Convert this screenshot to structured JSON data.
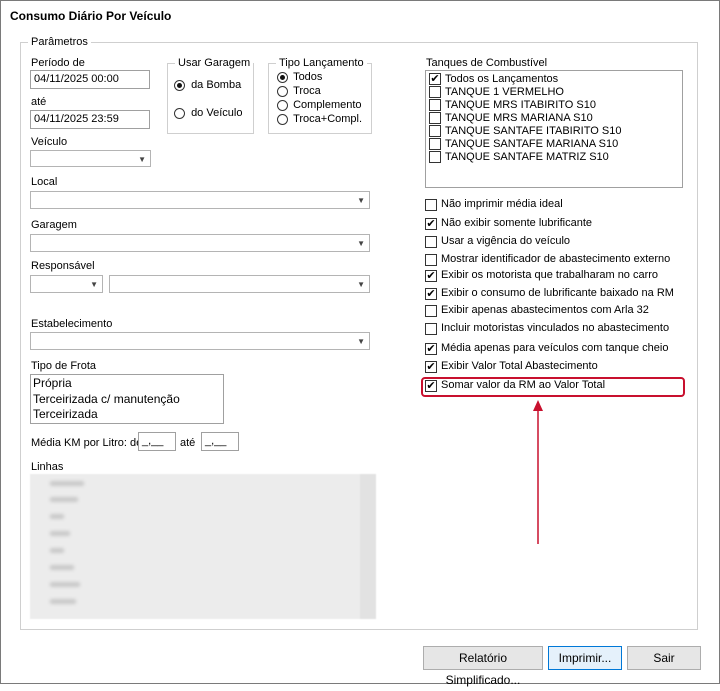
{
  "window": {
    "title": "Consumo Diário Por Veículo"
  },
  "params": {
    "legend": "Parâmetros",
    "periodo_label": "Período de",
    "periodo_de": "04/11/2025 00:00",
    "ate_label": "até",
    "periodo_ate": "04/11/2025 23:59",
    "veiculo_label": "Veículo",
    "local_label": "Local",
    "garagem_label": "Garagem",
    "responsavel_label": "Responsável",
    "estabelecimento_label": "Estabelecimento",
    "tipo_frota_label": "Tipo de Frota",
    "tipo_frota_items": [
      "Própria",
      "Terceirizada c/ manutenção",
      "Terceirizada"
    ],
    "media_km_label": "Média KM por Litro: de",
    "media_km_de": "_,__",
    "media_km_ate_label": "até",
    "media_km_ate": "_,__",
    "linhas_label": "Linhas"
  },
  "usar_garagem": {
    "legend": "Usar Garagem",
    "options": [
      {
        "label": "da Bomba",
        "selected": true
      },
      {
        "label": "do Veículo",
        "selected": false
      }
    ]
  },
  "tipo_lancamento": {
    "legend": "Tipo Lançamento",
    "options": [
      {
        "label": "Todos",
        "selected": true
      },
      {
        "label": "Troca",
        "selected": false
      },
      {
        "label": "Complemento",
        "selected": false
      },
      {
        "label": "Troca+Compl.",
        "selected": false
      }
    ]
  },
  "tanques": {
    "label": "Tanques de Combustível",
    "items": [
      {
        "label": "Todos os Lançamentos",
        "checked": true
      },
      {
        "label": "TANQUE 1 VERMELHO",
        "checked": false
      },
      {
        "label": "TANQUE MRS ITABIRITO S10",
        "checked": false
      },
      {
        "label": "TANQUE MRS MARIANA S10",
        "checked": false
      },
      {
        "label": "TANQUE SANTAFE ITABIRITO S10",
        "checked": false
      },
      {
        "label": "TANQUE SANTAFE MARIANA S10",
        "checked": false
      },
      {
        "label": "TANQUE SANTAFE MATRIZ S10",
        "checked": false
      }
    ]
  },
  "options": [
    {
      "label": "Não imprimir média ideal",
      "checked": false
    },
    {
      "label": "Não exibir somente lubrificante",
      "checked": true
    },
    {
      "label": "Usar a vigência do veículo",
      "checked": false
    },
    {
      "label": "Mostrar identificador de abastecimento externo",
      "checked": false
    },
    {
      "label": "Exibir os motorista que trabalharam no carro",
      "checked": true
    },
    {
      "label": "Exibir o consumo de lubrificante baixado na RM",
      "checked": true
    },
    {
      "label": "Exibir apenas abastecimentos com Arla 32",
      "checked": false
    },
    {
      "label": "Incluir motoristas vinculados no abastecimento",
      "checked": false
    },
    {
      "label": "Média apenas para veículos com tanque cheio",
      "checked": true
    },
    {
      "label": "Exibir Valor Total Abastecimento",
      "checked": true
    },
    {
      "label": "Somar valor da RM ao Valor Total",
      "checked": true
    }
  ],
  "buttons": {
    "relatorio": "Relatório Simplificado...",
    "imprimir": "Imprimir...",
    "sair": "Sair"
  },
  "colors": {
    "highlight": "#c8102e",
    "arrow": "#c8102e"
  }
}
